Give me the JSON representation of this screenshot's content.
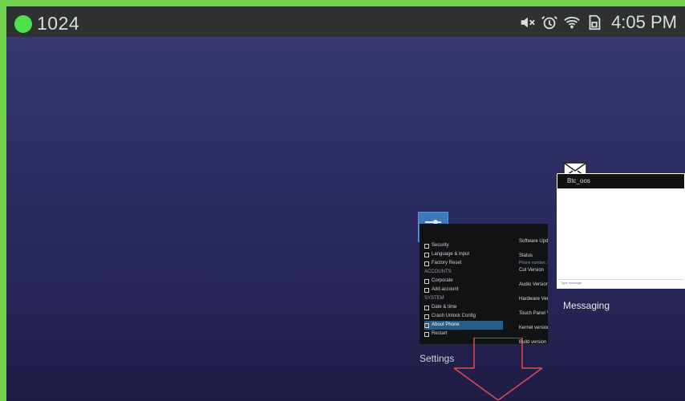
{
  "status_bar": {
    "label": "1024",
    "time": "4:05 PM",
    "icons": [
      "volume-muted-icon",
      "alarm-icon",
      "wifi-icon",
      "sim-icon"
    ],
    "status_dot_color": "#4ee24a"
  },
  "recent_apps": [
    {
      "name": "Settings",
      "label": "Settings",
      "settings_preview": {
        "left_list": [
          {
            "text": "Security"
          },
          {
            "text": "Language & input"
          },
          {
            "text": "Factory Reset"
          },
          {
            "text": "ACCOUNTS",
            "section": true
          },
          {
            "text": "Corporate"
          },
          {
            "text": "Add account"
          },
          {
            "text": "SYSTEM",
            "section": true
          },
          {
            "text": "Date & time"
          },
          {
            "text": "Crash Unlock Config"
          },
          {
            "text": "About Phone",
            "active": true
          },
          {
            "text": "Restart"
          }
        ],
        "right_list": [
          {
            "k": "Software Update",
            "v": ""
          },
          {
            "k": "Status",
            "v": "Phone number, signal, etc."
          },
          {
            "k": "Cut Version",
            "v": ""
          },
          {
            "k": "Audio Version",
            "v": ""
          },
          {
            "k": "Hardware Version",
            "v": ""
          },
          {
            "k": "Touch Panel Version",
            "v": ""
          },
          {
            "k": "Kernel version",
            "v": ""
          },
          {
            "k": "Build version",
            "v": ""
          }
        ]
      }
    },
    {
      "name": "Messaging",
      "label": "Messaging",
      "preview_top": "Btc_oos",
      "compose_placeholder": "Type message"
    }
  ],
  "colors": {
    "frame_green": "#6fd24a",
    "statusbar_bg": "#2f3130",
    "settings_blue": "#3f78b9",
    "arrow_red": "#e04b4b"
  }
}
